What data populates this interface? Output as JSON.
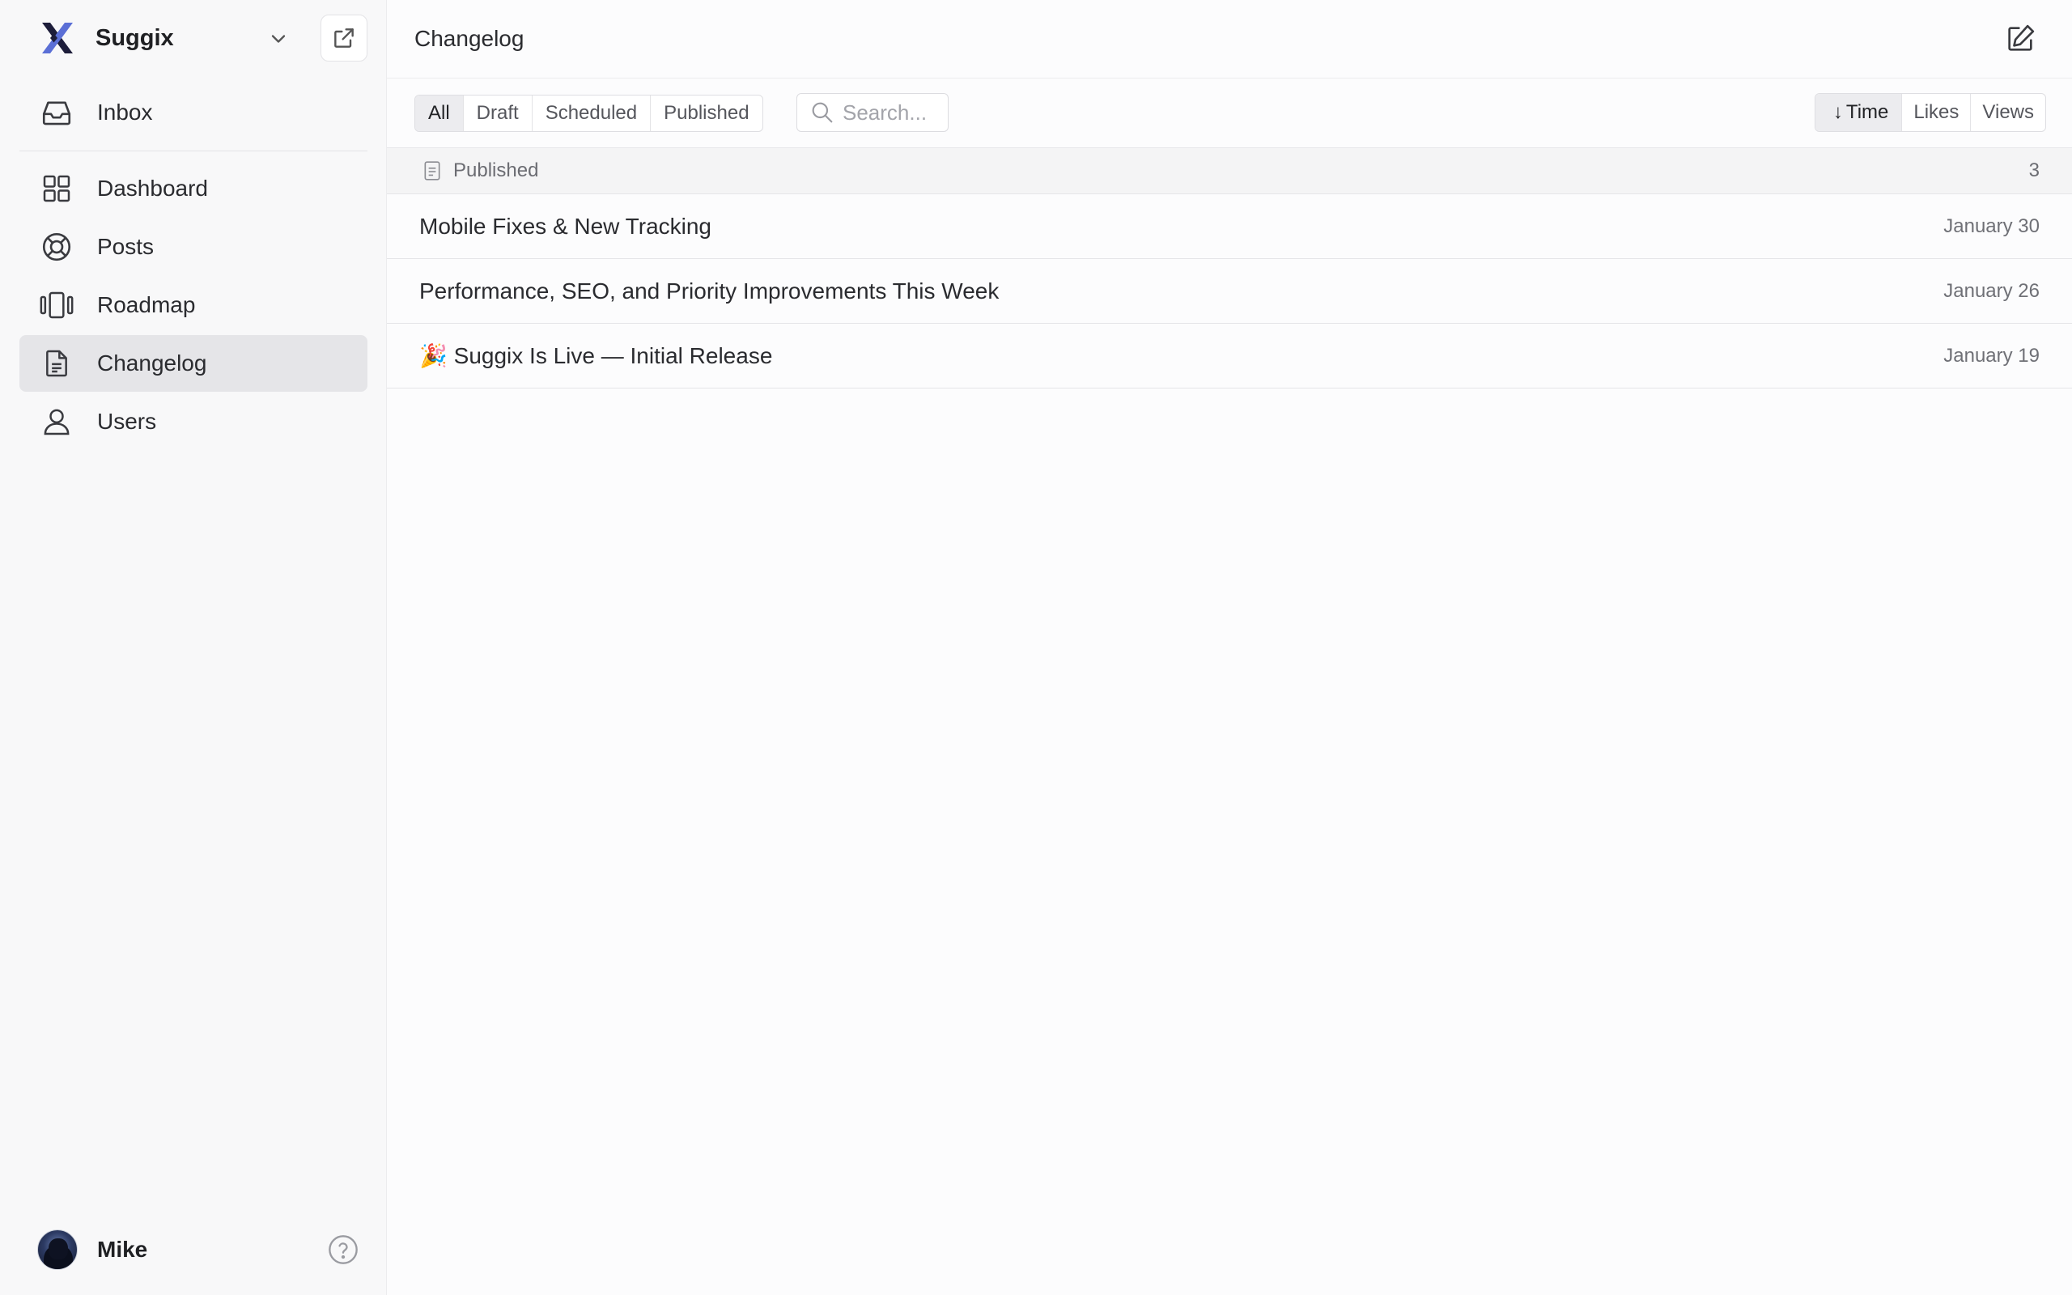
{
  "workspace": {
    "name": "Suggix"
  },
  "sidebar": {
    "items": [
      {
        "label": "Inbox",
        "icon": "inbox-icon"
      },
      {
        "label": "Dashboard",
        "icon": "grid-icon"
      },
      {
        "label": "Posts",
        "icon": "lifebuoy-icon"
      },
      {
        "label": "Roadmap",
        "icon": "columns-icon"
      },
      {
        "label": "Changelog",
        "icon": "document-icon",
        "active": true
      },
      {
        "label": "Users",
        "icon": "user-icon"
      }
    ]
  },
  "user": {
    "name": "Mike"
  },
  "header": {
    "title": "Changelog"
  },
  "filters": [
    "All",
    "Draft",
    "Scheduled",
    "Published"
  ],
  "active_filter": "All",
  "search": {
    "placeholder": "Search..."
  },
  "sort": {
    "arrow": "↓",
    "options": [
      "Time",
      "Likes",
      "Views"
    ],
    "active": "Time"
  },
  "group": {
    "label": "Published",
    "count": "3"
  },
  "entries": [
    {
      "title": "Mobile Fixes & New Tracking",
      "date": "January 30"
    },
    {
      "title": "Performance, SEO, and Priority Improvements This Week",
      "date": "January 26"
    },
    {
      "title": "🎉 Suggix Is Live — Initial Release",
      "date": "January 19"
    }
  ],
  "colors": {
    "brand_dark": "#1d1d3a",
    "brand_accent": "#5b6fd6",
    "active_bg": "#e5e5e8"
  }
}
